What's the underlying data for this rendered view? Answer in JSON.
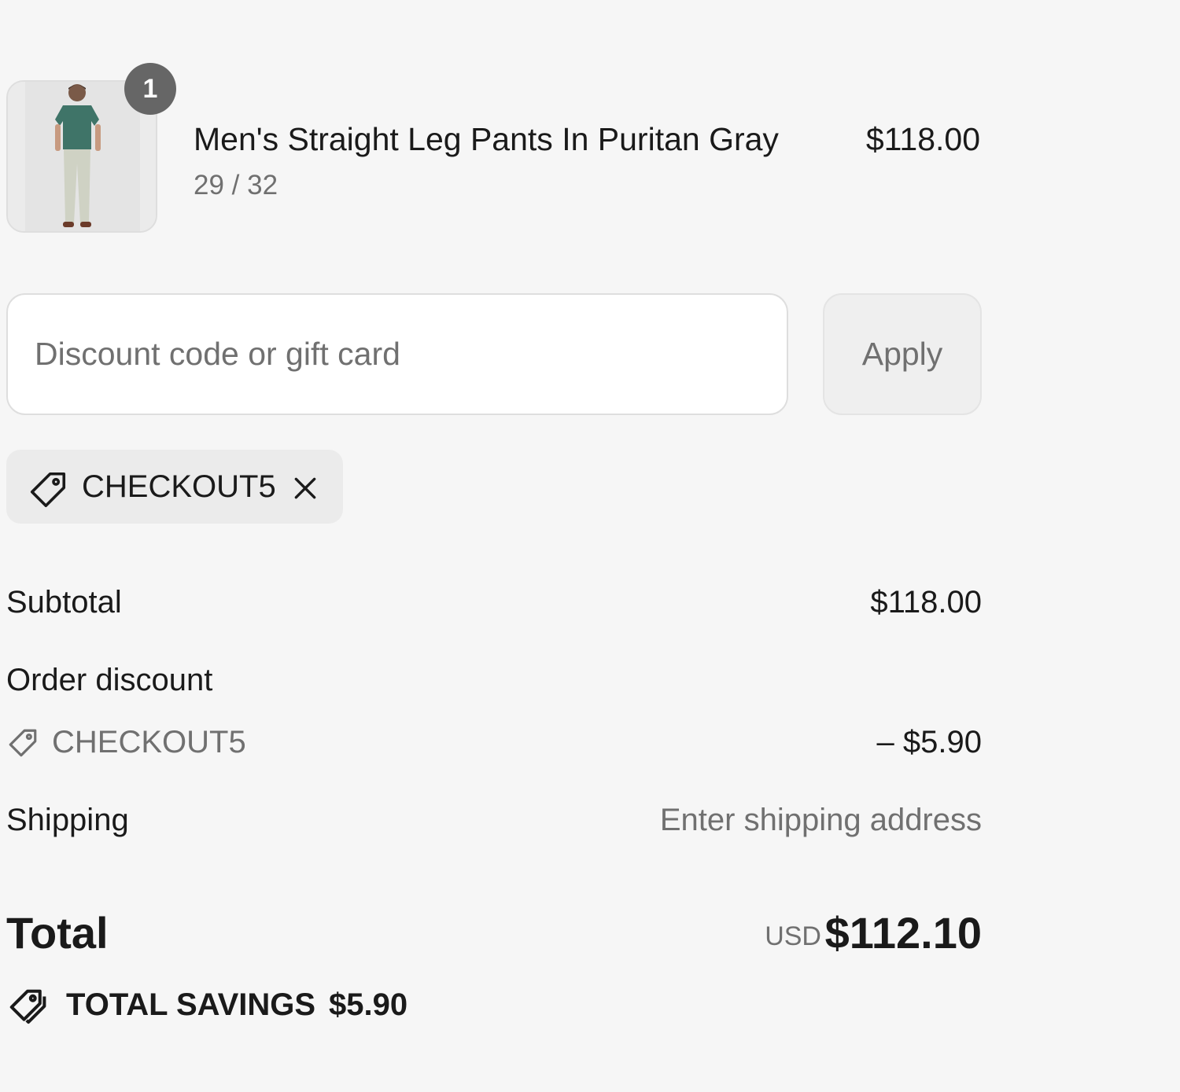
{
  "cart": {
    "items": [
      {
        "title": "Men's Straight Leg Pants In Puritan Gray",
        "variant": "29 / 32",
        "price": "$118.00",
        "quantity": "1"
      }
    ]
  },
  "discount": {
    "placeholder": "Discount code or gift card",
    "apply_label": "Apply",
    "applied_code": "CHECKOUT5"
  },
  "summary": {
    "subtotal_label": "Subtotal",
    "subtotal_value": "$118.00",
    "order_discount_label": "Order discount",
    "order_discount_code": "CHECKOUT5",
    "order_discount_value": "– $5.90",
    "shipping_label": "Shipping",
    "shipping_value": "Enter shipping address",
    "total_label": "Total",
    "currency": "USD",
    "total_value": "$112.10",
    "savings_label": "TOTAL SAVINGS",
    "savings_value": "$5.90"
  },
  "icons": {
    "tag": "tag-icon",
    "close": "close-icon",
    "savings": "savings-tags-icon"
  },
  "colors": {
    "background": "#f6f6f6",
    "badge": "#666666",
    "muted_text": "#707070"
  }
}
